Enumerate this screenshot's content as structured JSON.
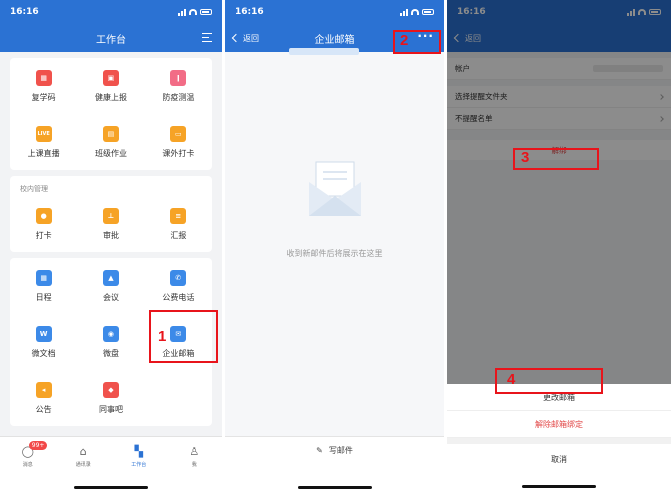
{
  "workbench": {
    "time": "16:16",
    "title": "工作台",
    "group1": [
      {
        "label": "复学码",
        "icon": "qr-code-icon",
        "color": "#f0524c"
      },
      {
        "label": "健康上报",
        "icon": "health-report-icon",
        "color": "#f0524c"
      },
      {
        "label": "防疫测温",
        "icon": "thermometer-icon",
        "color": "#f26c86"
      },
      {
        "label": "上课直播",
        "icon": "live-icon",
        "color": "#f6a326"
      },
      {
        "label": "班级作业",
        "icon": "homework-icon",
        "color": "#f6a326"
      },
      {
        "label": "课外打卡",
        "icon": "checkin-card-icon",
        "color": "#f6a326"
      }
    ],
    "section_title": "校内管理",
    "group2": [
      {
        "label": "打卡",
        "icon": "location-pin-icon",
        "color": "#f6a326"
      },
      {
        "label": "审批",
        "icon": "approval-icon",
        "color": "#f6a326"
      },
      {
        "label": "汇报",
        "icon": "report-icon",
        "color": "#f6a326"
      }
    ],
    "group3": [
      {
        "label": "日程",
        "icon": "calendar-icon",
        "color": "#3c8ae8"
      },
      {
        "label": "会议",
        "icon": "meeting-icon",
        "color": "#3c8ae8"
      },
      {
        "label": "公费电话",
        "icon": "phone-icon",
        "color": "#3c8ae8"
      },
      {
        "label": "微文档",
        "icon": "document-icon",
        "color": "#3c8ae8"
      },
      {
        "label": "微盘",
        "icon": "drive-icon",
        "color": "#3c8ae8"
      },
      {
        "label": "企业邮箱",
        "icon": "mail-icon",
        "color": "#3c8ae8"
      },
      {
        "label": "公告",
        "icon": "announcement-icon",
        "color": "#f6a326"
      },
      {
        "label": "同事吧",
        "icon": "colleague-forum-icon",
        "color": "#f0524c"
      }
    ],
    "tabs": [
      {
        "label": "消息",
        "badge": "99+"
      },
      {
        "label": "通讯录"
      },
      {
        "label": "工作台"
      },
      {
        "label": "我"
      }
    ]
  },
  "mailbox": {
    "time": "16:16",
    "back": "返回",
    "title": "企业邮箱",
    "empty_text": "收到新邮件后将展示在这里",
    "compose": "写邮件"
  },
  "settings": {
    "time": "16:16",
    "back": "返回",
    "rows": [
      {
        "label": "帐户"
      },
      {
        "label": "选择提醒文件夹"
      },
      {
        "label": "不提醒名单"
      }
    ],
    "unbind": "解绑",
    "sheet": {
      "change": "更改邮箱",
      "unbind": "解除邮箱绑定",
      "cancel": "取消"
    }
  },
  "annotations": [
    "1",
    "2",
    "3",
    "4"
  ],
  "colors": {
    "brand_blue": "#2b72d3",
    "highlight_red": "#e8141b"
  }
}
